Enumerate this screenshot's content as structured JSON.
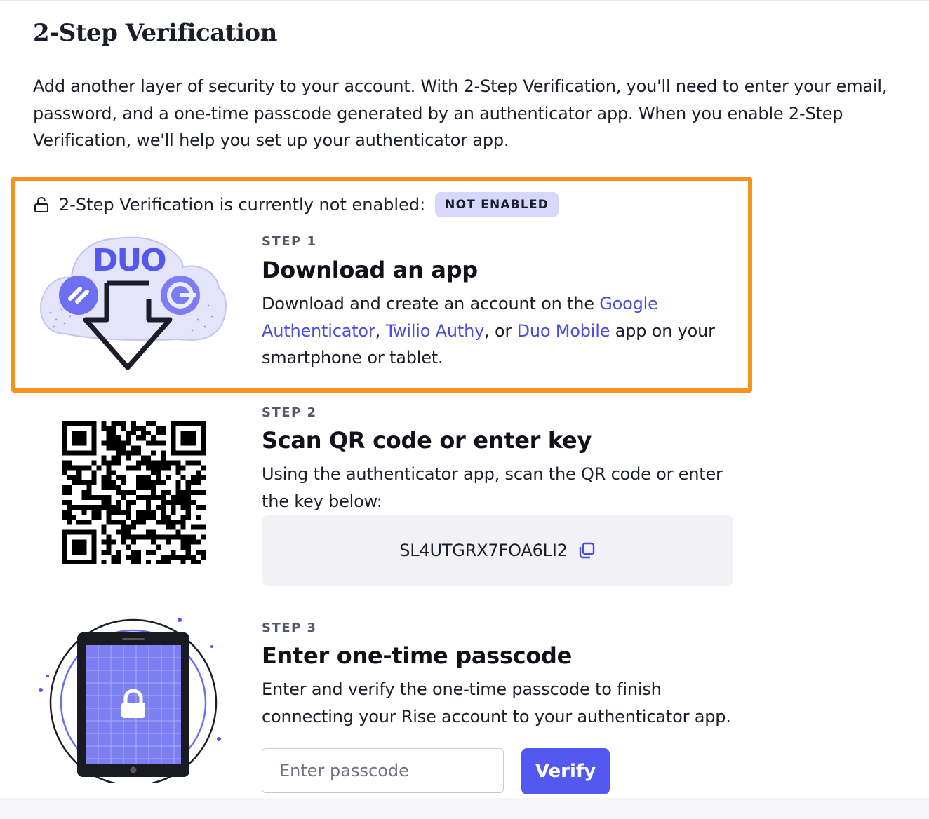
{
  "page": {
    "title": "2-Step Verification",
    "intro": "Add another layer of security to your account. With 2-Step Verification, you'll need to enter your email, password, and a one-time passcode generated by an authenticator app. When you enable 2-Step Verification, we'll help you set up your authenticator app."
  },
  "status": {
    "icon": "unlocked-padlock-icon",
    "text": "2-Step Verification is currently not enabled:",
    "badge": "NOT ENABLED"
  },
  "steps": [
    {
      "label": "STEP 1",
      "title": "Download an app",
      "desc_before": "Download and create an account on the ",
      "links": [
        "Google Authenticator",
        "Twilio Authy",
        "Duo Mobile"
      ],
      "sep1": ", ",
      "sep2": ", or ",
      "desc_after": " app on your smartphone or tablet.",
      "illustration_text": "DUO"
    },
    {
      "label": "STEP 2",
      "title": "Scan QR code or enter key",
      "desc": "Using the authenticator app, scan the QR code or enter the key below:",
      "key": "SL4UTGRX7FOA6LI2",
      "copy_icon": "copy-icon"
    },
    {
      "label": "STEP 3",
      "title": "Enter one-time passcode",
      "desc": "Enter and verify the one-time passcode to finish connecting your Rise account to your authenticator app.",
      "input_placeholder": "Enter passcode",
      "input_value": "",
      "button": "Verify"
    }
  ],
  "colors": {
    "accent": "#5359ee",
    "link": "#4a4ee0",
    "highlight_border": "#f7931e",
    "badge_bg": "#d6d7fb",
    "key_box_bg": "#f1f1f6"
  }
}
